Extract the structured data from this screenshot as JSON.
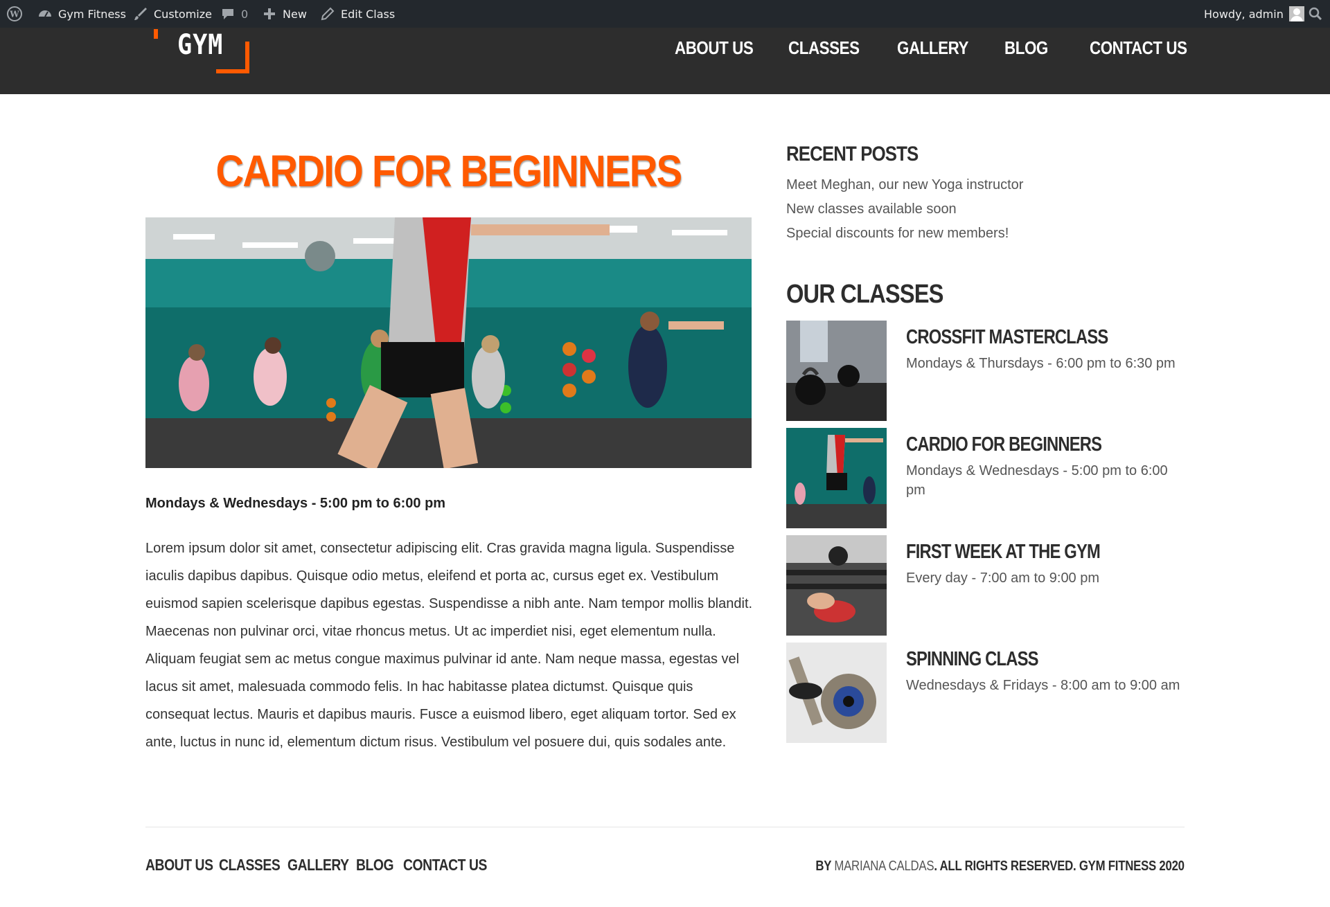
{
  "admin_bar": {
    "site_name": "Gym Fitness",
    "customize": "Customize",
    "comments_count": "0",
    "new_label": "New",
    "edit_label": "Edit Class",
    "howdy": "Howdy, admin"
  },
  "header": {
    "logo_text": "GYM",
    "nav": [
      "ABOUT US",
      "CLASSES",
      "GALLERY",
      "BLOG",
      "CONTACT US"
    ],
    "accent_color": "#ff5a00",
    "bg_color": "#2d2d2d"
  },
  "post": {
    "title": "CARDIO FOR BEGINNERS",
    "schedule": "Mondays & Wednesdays - 5:00 pm to 6:00 pm",
    "body": "Lorem ipsum dolor sit amet, consectetur adipiscing elit. Cras gravida magna ligula. Suspendisse iaculis dapibus dapibus. Quisque odio metus, eleifend et porta ac, cursus eget ex. Vestibulum euismod sapien scelerisque dapibus egestas. Suspendisse a nibh ante. Nam tempor mollis blandit. Maecenas non pulvinar orci, vitae rhoncus metus. Ut ac imperdiet nisi, eget elementum nulla. Aliquam feugiat sem ac metus congue maximus pulvinar id ante. Nam neque massa, egestas vel lacus sit amet, malesuada commodo felis. In hac habitasse platea dictumst. Quisque quis consequat lectus. Mauris et dapibus mauris. Fusce a euismod libero, eget aliquam tortor. Sed ex ante, luctus in nunc id, elementum dictum risus. Vestibulum vel posuere dui, quis sodales ante."
  },
  "sidebar": {
    "recent_title": "RECENT POSTS",
    "recent_posts": [
      "Meet Meghan, our new Yoga instructor",
      "New classes available soon",
      "Special discounts for new members!"
    ],
    "classes_title": "OUR CLASSES",
    "classes": [
      {
        "name": "CROSSFIT MASTERCLASS",
        "time": "Mondays & Thursdays - 6:00 pm to 6:30 pm"
      },
      {
        "name": "CARDIO FOR BEGINNERS",
        "time": "Mondays & Wednesdays - 5:00 pm to 6:00 pm"
      },
      {
        "name": "FIRST WEEK AT THE GYM",
        "time": "Every day - 7:00 am to 9:00 pm"
      },
      {
        "name": "SPINNING CLASS",
        "time": "Wednesdays & Fridays - 8:00 am to 9:00 am"
      }
    ]
  },
  "footer": {
    "nav": [
      "ABOUT US",
      "CLASSES",
      "GALLERY",
      "BLOG",
      "CONTACT US"
    ],
    "copyright_prefix": "BY ",
    "author": "MARIANA CALDAS",
    "copyright_suffix": ". ALL RIGHTS RESERVED. GYM FITNESS 2020"
  }
}
